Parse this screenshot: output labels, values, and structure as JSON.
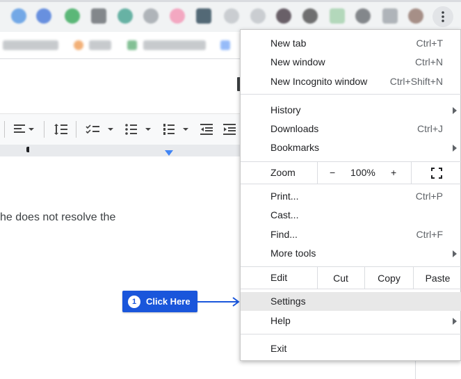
{
  "doc": {
    "body_text": "he does not resolve the"
  },
  "callout": {
    "number": "1",
    "label": "Click Here"
  },
  "menu": {
    "new_tab": {
      "label": "New tab",
      "shortcut": "Ctrl+T"
    },
    "new_window": {
      "label": "New window",
      "shortcut": "Ctrl+N"
    },
    "new_incognito": {
      "label": "New Incognito window",
      "shortcut": "Ctrl+Shift+N"
    },
    "history": {
      "label": "History"
    },
    "downloads": {
      "label": "Downloads",
      "shortcut": "Ctrl+J"
    },
    "bookmarks": {
      "label": "Bookmarks"
    },
    "zoom": {
      "label": "Zoom",
      "minus": "−",
      "value": "100%",
      "plus": "+"
    },
    "print": {
      "label": "Print...",
      "shortcut": "Ctrl+P"
    },
    "cast": {
      "label": "Cast..."
    },
    "find": {
      "label": "Find...",
      "shortcut": "Ctrl+F"
    },
    "more_tools": {
      "label": "More tools"
    },
    "edit": {
      "label": "Edit",
      "cut": "Cut",
      "copy": "Copy",
      "paste": "Paste"
    },
    "settings": {
      "label": "Settings"
    },
    "help": {
      "label": "Help"
    },
    "exit": {
      "label": "Exit"
    }
  },
  "colors": {
    "callout_blue": "#1a56db",
    "menu_highlight": "#e8e8e8",
    "ruler_marker": "#4285f4"
  }
}
